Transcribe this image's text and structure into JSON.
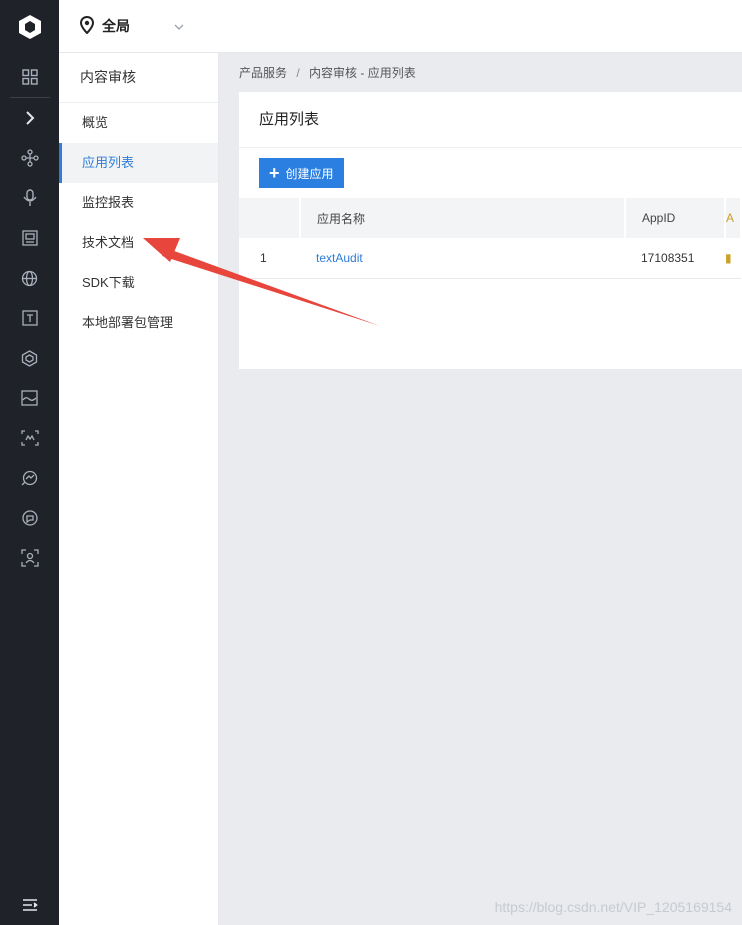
{
  "topbar": {
    "region_label": "全局"
  },
  "rail": {
    "icons": [
      "logo-icon",
      "grid-icon",
      "chevron-right-icon",
      "nodes-icon",
      "microphone-icon",
      "image-card-icon",
      "globe-icon",
      "text-icon",
      "cube-icon",
      "picture-frame-icon",
      "face-scan-icon",
      "analytics-icon",
      "speech-icon",
      "person-scan-icon",
      "menu-collapse-icon"
    ]
  },
  "subnav": {
    "title": "内容审核",
    "items": [
      {
        "label": "概览"
      },
      {
        "label": "应用列表"
      },
      {
        "label": "监控报表"
      },
      {
        "label": "技术文档"
      },
      {
        "label": "SDK下载"
      },
      {
        "label": "本地部署包管理"
      }
    ]
  },
  "breadcrumb": {
    "root": "产品服务",
    "separator": "/",
    "current": "内容审核 - 应用列表"
  },
  "main": {
    "title": "应用列表",
    "create_button": "创建应用",
    "table": {
      "headers": [
        "",
        "应用名称",
        "AppID"
      ],
      "rows": [
        {
          "index": "1",
          "name": "textAudit",
          "appid": "17108351"
        }
      ]
    }
  },
  "annotation": {
    "arrow_color": "#e8453c"
  },
  "watermark": "https://blog.csdn.net/VIP_1205169154"
}
